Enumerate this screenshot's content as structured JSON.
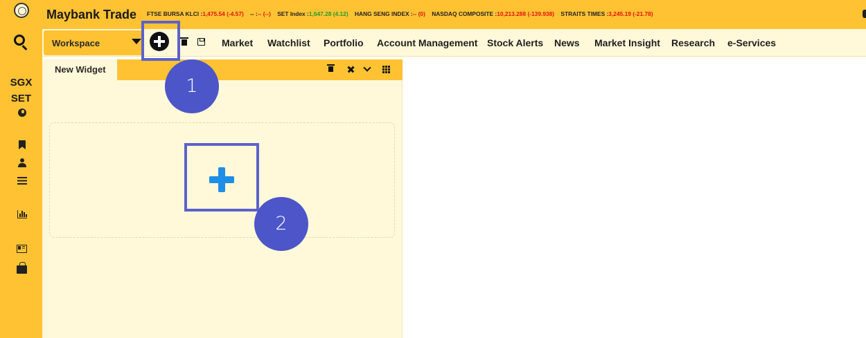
{
  "app": {
    "brand": "Maybank Trade"
  },
  "ticker": [
    {
      "name": "FTSE BURSA KLCI :",
      "value": "1,475.54  (-4.57)",
      "trend": "down"
    },
    {
      "name": "-- :",
      "value": "--  (--)",
      "trend": "down"
    },
    {
      "name": "SET Index :",
      "value": "1,647.28  (4.12)",
      "trend": "up"
    },
    {
      "name": "HANG SENG INDEX :",
      "value": "--  (0)",
      "trend": "down"
    },
    {
      "name": "NASDAQ COMPOSITE :",
      "value": "10,213.288  (-139.938)",
      "trend": "down"
    },
    {
      "name": "STRAITS TIMES :",
      "value": "3,245.19  (-21.78)",
      "trend": "down"
    }
  ],
  "sidebar": {
    "sgx_label": "SGX",
    "set_label": "SET"
  },
  "toolbar": {
    "workspace_label": "Workspace"
  },
  "menu": [
    "Market",
    "Watchlist",
    "Portfolio",
    "Account Management",
    "Stock Alerts",
    "News",
    "Market Insight",
    "Research",
    "e-Services"
  ],
  "widget": {
    "tab_label": "New Widget"
  },
  "annotations": {
    "step1": "1",
    "step2": "2"
  },
  "colors": {
    "brand_yellow": "#fec233",
    "panel": "#fff8d9",
    "accent_blue": "#1e8ee6",
    "annotation": "#4c56c8"
  }
}
